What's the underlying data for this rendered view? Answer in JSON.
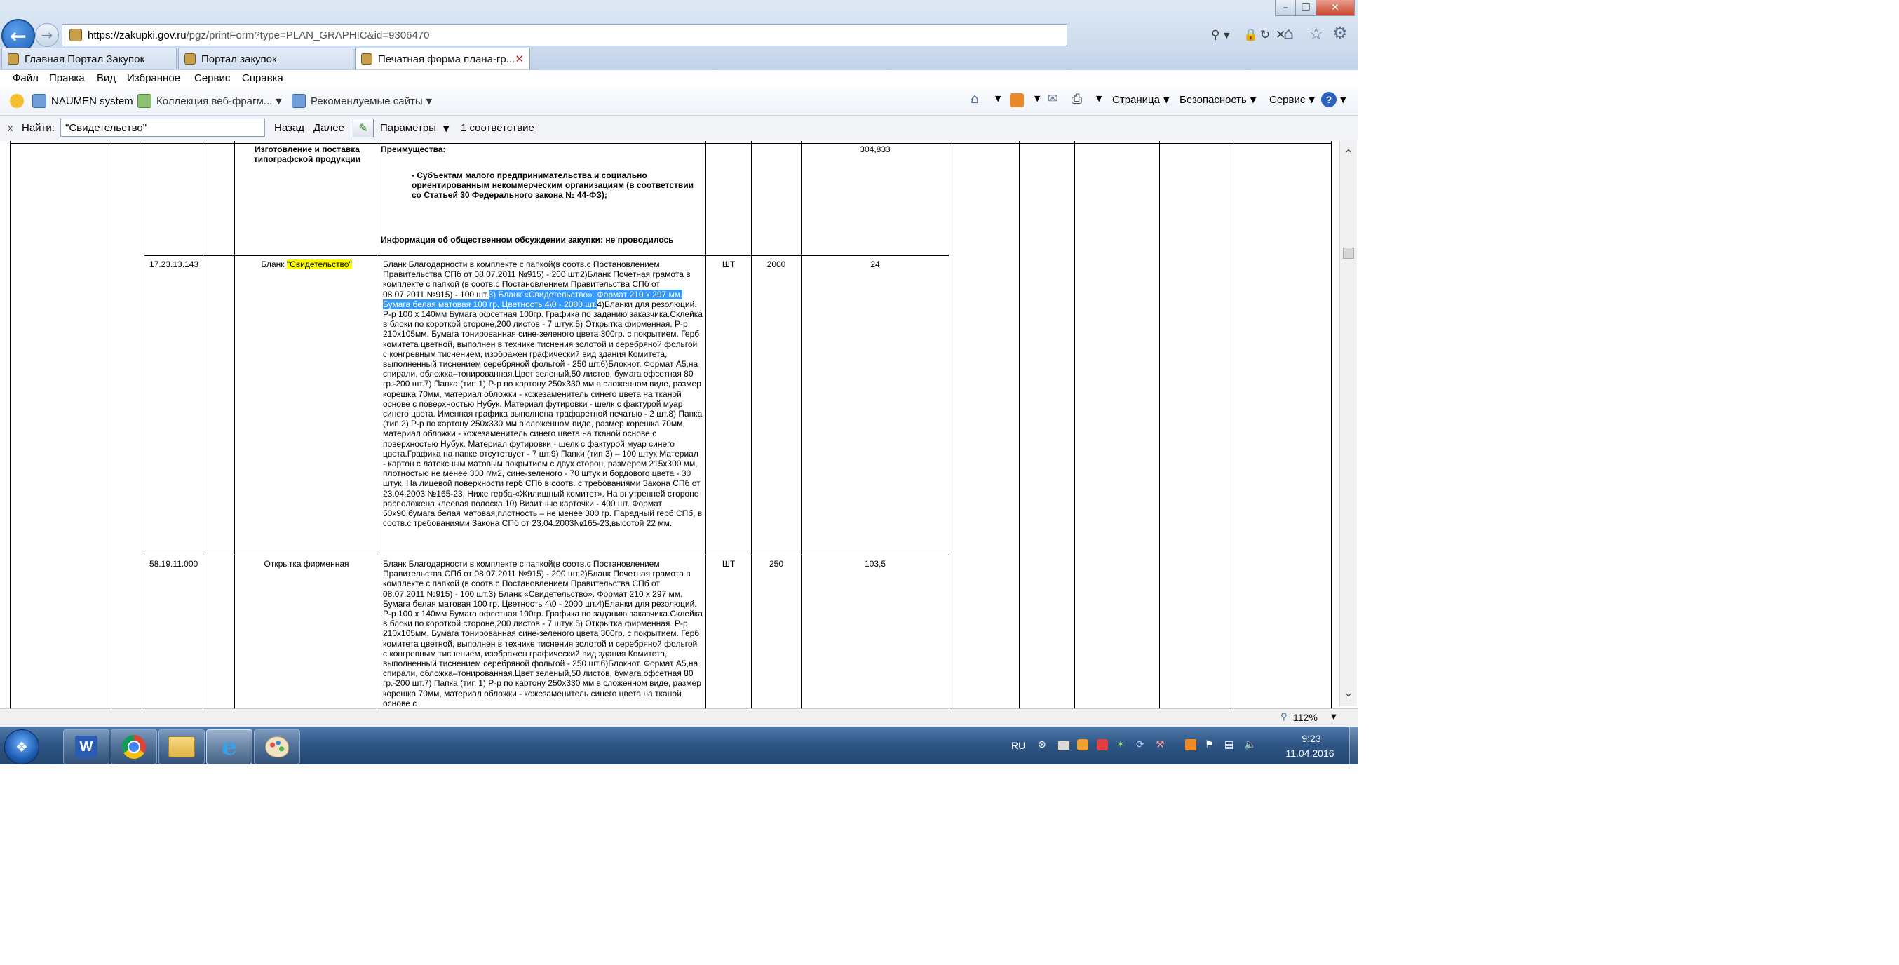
{
  "browser": {
    "url_host": "https://zakupki.gov.ru",
    "url_rest": "/pgz/printForm?type=PLAN_GRAPHIC&id=9306470",
    "tabs": [
      {
        "label": "Главная Портал Закупок"
      },
      {
        "label": "Портал закупок"
      },
      {
        "label": "Печатная форма плана-гр..."
      }
    ],
    "menu": [
      "Файл",
      "Правка",
      "Вид",
      "Избранное",
      "Сервис",
      "Справка"
    ],
    "favorites": [
      {
        "label": "NAUMEN system"
      },
      {
        "label": "Коллекция веб-фрагм..."
      },
      {
        "label": "Рекомендуемые сайты"
      }
    ],
    "command_bar": [
      "Страница",
      "Безопасность",
      "Сервис"
    ]
  },
  "findbar": {
    "close": "x",
    "label": "Найти:",
    "query": "\"Свидетельство\"",
    "back": "Назад",
    "next": "Далее",
    "options": "Параметры",
    "result": "1 соответствие"
  },
  "table": {
    "row0": {
      "name": "Изготовление и поставка типографской продукции",
      "price": "304,833",
      "adv_title": "Преимущества:",
      "adv_text": "- Субъектам малого предпринимательства и социально ориентированным некоммерческим организациям (в соответствии со Статьей 30 Федерального закона № 44-ФЗ);",
      "discussion": "Информация об общественном обсуждении закупки: не проводилось"
    },
    "row1": {
      "code": "17.23.13.143",
      "name_prefix": "Бланк ",
      "name_highlight": "\"Свидетельство\"",
      "desc_before": "Бланк Благодарности в комплекте с папкой(в соотв.с Постановлением Правительства СПб от 08.07.2011 №915) - 200 шт.2)Бланк Почетная грамота в комплекте с папкой (в соотв.с Постановлением Правительства СПб от 08.07.2011 №915) - 100 шт.",
      "desc_selected": "3) Бланк «Свидетельство». Формат 210 х 297 мм. Бумага белая матовая 100 гр. Цветность 4\\0 - 2000 шт.",
      "desc_after": "4)Бланки для резолюций. Р-р 100 х 140мм Бумага офсетная 100гр. Графика по заданию заказчика.Склейка в блоки по короткой стороне,200 листов - 7 штук.5) Открытка фирменная. Р-р 210х105мм. Бумага тонированная сине-зеленого цвета 300гр. с покрытием. Герб комитета цветной, выполнен в технике тиснения золотой и серебряной фольгой с конгревным тиснением, изображен графический вид здания Комитета, выполненный тиснением серебряной фольгой - 250 шт.6)Блокнот. Формат А5,на спирали, обложка–тонированная.Цвет зеленый,50 листов, бумага офсетная 80 гр.-200 шт.7) Папка (тип 1) Р-р по картону 250х330 мм в сложенном виде, размер корешка 70мм, материал обложки - кожезаменитель синего цвета на тканой основе с поверхностью Нубук. Материал футировки - шелк с фактурой муар синего цвета. Именная графика выполнена трафаретной печатью - 2 шт.8) Папка (тип 2) Р-р по картону 250х330 мм в сложенном виде, размер корешка 70мм, материал обложки - кожезаменитель синего цвета на тканой основе с поверхностью Нубук. Материал футировки - шелк с фактурой муар синего цвета.Графика на папке отсутствует - 7 шт.9) Папки (тип 3) – 100 штук Материал - картон с латексным матовым покрытием с двух сторон, размером 215х300 мм, плотностью не менее 300 г/м2, сине-зеленого - 70 штук и бордового цвета - 30 штук. На лицевой поверхности герб СПб в соотв. с требованиями Закона СПб от 23.04.2003 №165-23. Ниже герба-«Жилищный комитет». На внутренней стороне расположена клеевая полоска.10) Визитные карточки - 400 шт. Формат 50х90,бумага белая матовая,плотность – не менее 300 гр. Парадный герб СПб, в соотв.с требованиями Закона СПб от 23.04.2003№165-23,высотой 22 мм.",
      "unit": "ШТ",
      "qty": "2000",
      "price": "24"
    },
    "row2": {
      "code": "58.19.11.000",
      "name": "Открытка фирменная",
      "desc": "Бланк Благодарности в комплекте с папкой(в соотв.с Постановлением Правительства СПб от 08.07.2011 №915) - 200 шт.2)Бланк Почетная грамота в комплекте с папкой (в соотв.с Постановлением Правительства СПб от 08.07.2011 №915) - 100 шт.3) Бланк «Свидетельство». Формат 210 х 297 мм. Бумага белая матовая 100 гр. Цветность 4\\0 - 2000 шт.4)Бланки для резолюций. Р-р 100 х 140мм Бумага офсетная 100гр. Графика по заданию заказчика.Склейка в блоки по короткой стороне,200 листов - 7 штук.5) Открытка фирменная. Р-р 210х105мм. Бумага тонированная сине-зеленого цвета 300гр. с покрытием. Герб комитета цветной, выполнен в технике тиснения золотой и серебряной фольгой с конгревным тиснением, изображен графический вид здания Комитета, выполненный тиснением серебряной фольгой - 250 шт.6)Блокнот. Формат А5,на спирали, обложка–тонированная.Цвет зеленый,50 листов, бумага офсетная 80 гр.-200 шт.7) Папка (тип 1) Р-р по картону 250х330 мм в сложенном виде, размер корешка 70мм, материал обложки - кожезаменитель синего цвета на тканой основе с",
      "unit": "ШТ",
      "qty": "250",
      "price": "103,5"
    }
  },
  "status": {
    "zoom": "112%"
  },
  "taskbar": {
    "lang": "RU",
    "time": "9:23",
    "date": "11.04.2016"
  },
  "colors": {
    "selection": "#3399ff",
    "find_highlight": "#ffff00",
    "taskbar": "#2e5585"
  }
}
